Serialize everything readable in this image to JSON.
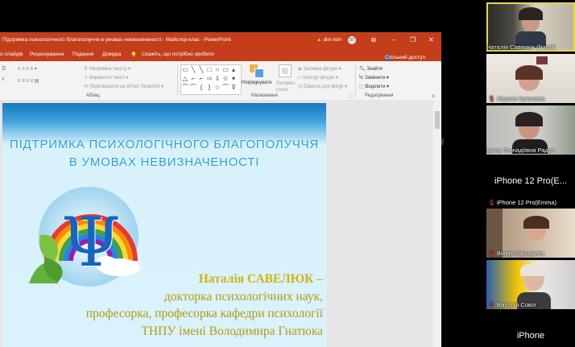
{
  "powerpoint": {
    "window_title": "Підтримка психологічного благополуччя в умовах невизначеності - Майстер-клас - PowerPoint",
    "user_name": "dim ksh",
    "user_initials": "DT",
    "window_controls": {
      "ribbon_display": "⧉",
      "minimize": "–",
      "restore": "❐",
      "close": "✕"
    },
    "menu": [
      "о слайдів",
      "Рецензування",
      "Подання",
      "Довідка"
    ],
    "tell_me": "Скажіть, що потрібно зробити",
    "share": "Спільний доступ",
    "ribbon": {
      "paragraph": {
        "text_direction": "Напрямок тексту",
        "align_text": "Вирівняти текст",
        "convert_smartart": "Перетворити на об'єкт SmartArt",
        "group_label": "Абзац"
      },
      "drawing": {
        "arrange": "Упорядкувати",
        "quick_styles": "Експрес-стилі",
        "shape_fill": "Заливка фігури",
        "shape_outline": "Контур фігури",
        "shape_effects": "Ефекти для фігур",
        "group_label": "Малювання"
      },
      "editing": {
        "find": "Знайти",
        "replace": "Замінити",
        "select": "Виділити",
        "group_label": "Редагування"
      }
    },
    "slide": {
      "title_line1": "ПІДТРИМКА ПСИХОЛОГІЧНОГО БЛАГОПОЛУЧЧЯ",
      "title_line2": "В УМОВАХ НЕВИЗНАЧЕНОСТІ",
      "author_name": "Наталія САВЕЛЮК –",
      "author_line1": "докторка психологічних наук,",
      "author_line2": "професорка, професорка кафедри психології",
      "author_line3": "ТНПУ імені Володимира Гнатюка",
      "logo_symbol": "Ψ"
    }
  },
  "participants": [
    {
      "name": "Наталія Савелюк (Natalii",
      "muted": false,
      "active": true
    },
    {
      "name": "Лариса Кулакова",
      "muted": true
    },
    {
      "name": "Ірина Геннадіївна Радул",
      "muted": false
    },
    {
      "name": "iPhone 12 Pro(E...",
      "muted": false,
      "video": false
    },
    {
      "name": "iPhone 12 Pro(Emma)",
      "muted": true
    },
    {
      "name": "Вінер Маргарита",
      "muted": true
    },
    {
      "name": "Вікторія Сокіл",
      "muted": true
    },
    {
      "name": "iPhone",
      "muted": false,
      "video": false
    }
  ],
  "icons": {
    "mic_muted": "mic-muted-icon",
    "warning": "warning-icon",
    "search": "search-icon",
    "lightbulb": "lightbulb-icon",
    "share": "person-icon"
  },
  "colors": {
    "ppt_accent": "#c43e1c",
    "active_speaker": "#e6d84c",
    "slide_title": "#2aa0d2",
    "author_name": "#d4b20f"
  }
}
